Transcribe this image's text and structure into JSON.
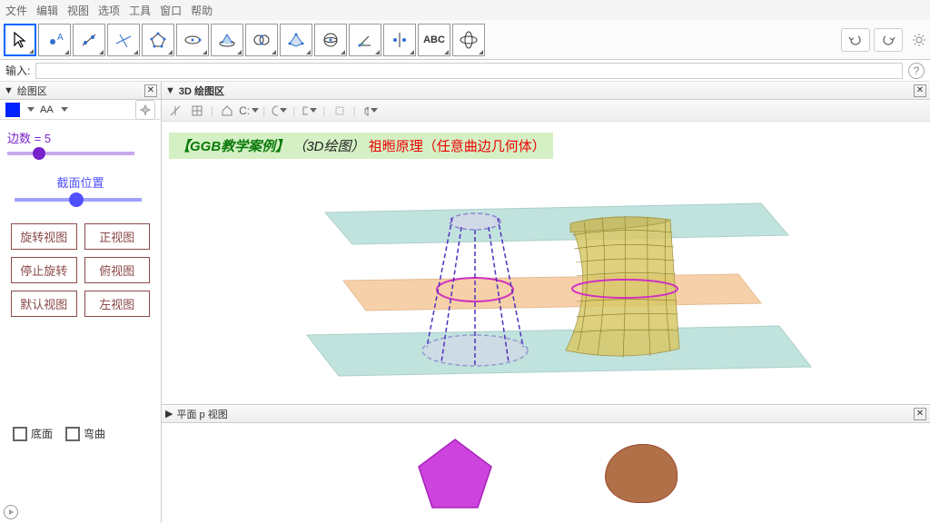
{
  "menu": {
    "file": "文件",
    "edit": "编辑",
    "view": "视图",
    "options": "选项",
    "tools": "工具",
    "window": "窗口",
    "help": "帮助"
  },
  "input_label": "输入:",
  "left_panel": {
    "title": "绘图区",
    "text_label": "AA"
  },
  "slider1": {
    "label": "边数 = 5",
    "value": 5
  },
  "slider2": {
    "label": "截面位置"
  },
  "buttons": {
    "b1": "旋转视图",
    "b2": "正视图",
    "b3": "停止旋转",
    "b4": "俯视图",
    "b5": "默认视图",
    "b6": "左视图"
  },
  "checks": {
    "c1": "底面",
    "c2": "弯曲"
  },
  "view3d": {
    "title": "3D 绘图区"
  },
  "banner": {
    "part1": "【GGB教学案例】",
    "part2": "（3D绘图）",
    "part3": "祖暅原理（任意曲边几何体）"
  },
  "planeview": {
    "title": "平面 p 视图"
  },
  "toolbar_abc": "ABC"
}
